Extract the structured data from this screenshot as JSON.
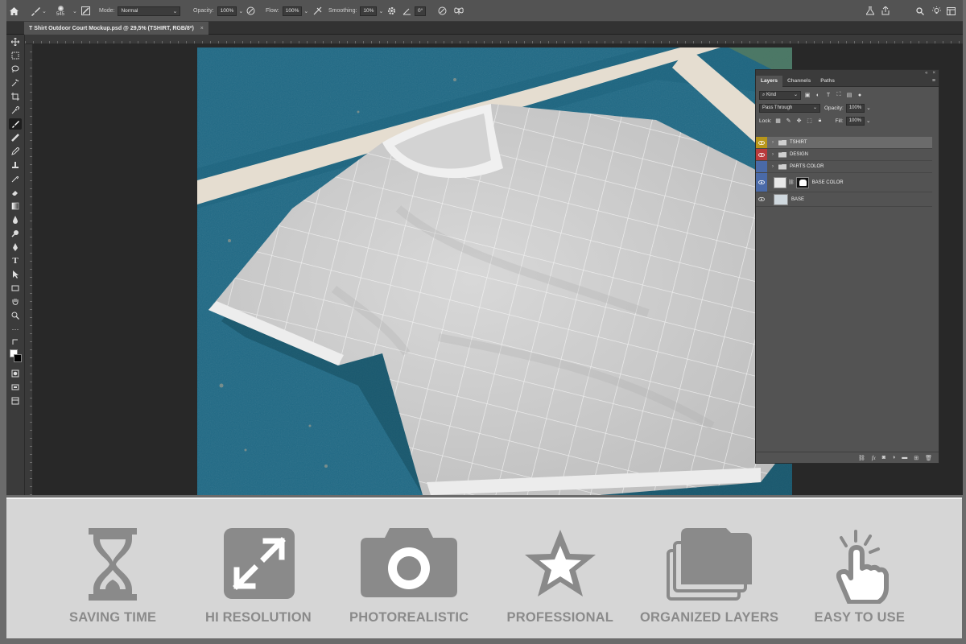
{
  "options_bar": {
    "brush_size": "545",
    "mode_label": "Mode:",
    "mode_value": "Normal",
    "opacity_label": "Opacity:",
    "opacity_value": "100%",
    "flow_label": "Flow:",
    "flow_value": "100%",
    "smoothing_label": "Smoothing:",
    "smoothing_value": "10%",
    "angle_value": "0°"
  },
  "document": {
    "tab_title": "T Shirt Outdoor Court Mockup.psd @ 29,5% (TSHIRT, RGB/8*)",
    "tab_close": "×"
  },
  "layers_panel": {
    "tabs": [
      "Layers",
      "Channels",
      "Paths"
    ],
    "filter_kind": "Kind",
    "blend_mode": "Pass Through",
    "opacity_label": "Opacity:",
    "opacity_value": "100%",
    "lock_label": "Lock:",
    "fill_label": "Fill:",
    "fill_value": "100%",
    "layers": [
      {
        "name": "TSHIRT",
        "type": "group",
        "color": "#c7a41a",
        "selected": true
      },
      {
        "name": "DESIGN",
        "type": "group",
        "color": "#c0393b",
        "selected": false
      },
      {
        "name": "PARTS COLOR",
        "type": "group",
        "color": "#4d6fb0",
        "selected": false
      },
      {
        "name": "BASE COLOR",
        "type": "layer-mask",
        "color": "#4d6fb0",
        "selected": false
      },
      {
        "name": "BASE",
        "type": "smart",
        "color": "#595959",
        "selected": false
      }
    ],
    "bottom_icons": [
      "link-icon",
      "fx-icon",
      "mask-icon",
      "adjustment-icon",
      "folder-icon",
      "new-layer-icon",
      "trash-icon"
    ]
  },
  "features": [
    {
      "label": "SAVING TIME",
      "icon": "hourglass-icon"
    },
    {
      "label": "HI RESOLUTION",
      "icon": "expand-icon"
    },
    {
      "label": "PHOTOREALISTIC",
      "icon": "camera-icon"
    },
    {
      "label": "PROFESSIONAL",
      "icon": "star-icon"
    },
    {
      "label": "ORGANIZED LAYERS",
      "icon": "layers-icon"
    },
    {
      "label": "EASY TO USE",
      "icon": "hand-click-icon"
    }
  ],
  "colors": {
    "court_blue": "#1e6a85",
    "court_line": "#e6dfd2",
    "shirt_gray": "#cfcfcf",
    "feature_gray": "#8a8a8a",
    "feature_bg": "#d6d6d6"
  }
}
